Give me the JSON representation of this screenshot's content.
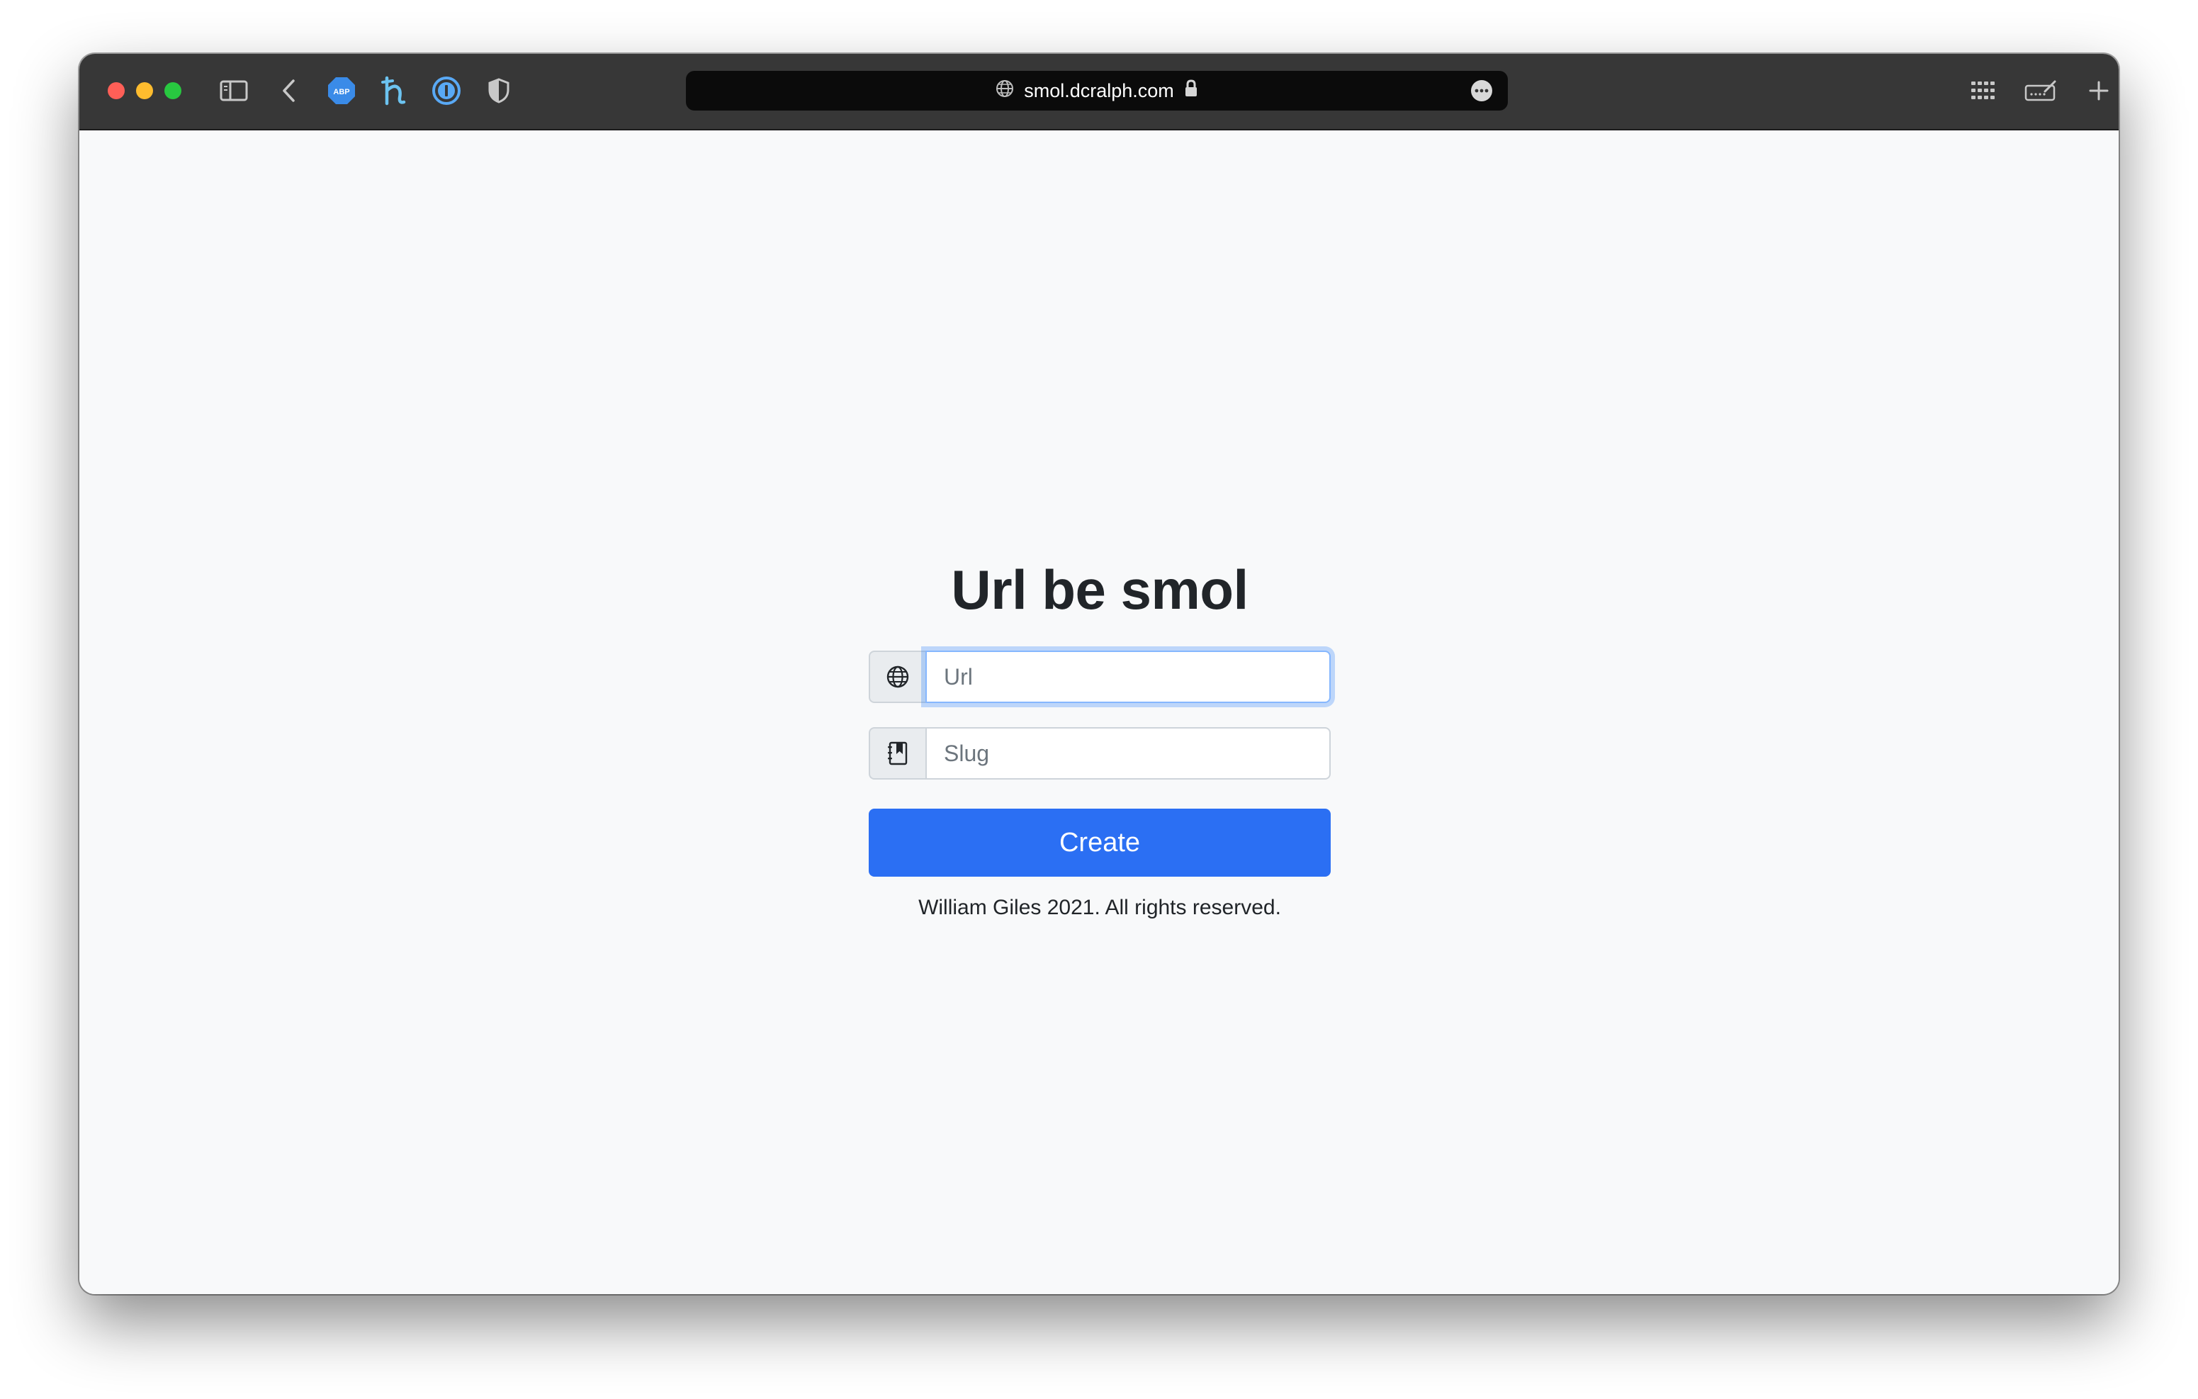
{
  "browser": {
    "url": "smol.dcralph.com",
    "extensions": [
      "abp-icon",
      "honey-icon",
      "onepassword-icon",
      "privacy-shield-icon"
    ]
  },
  "page": {
    "title": "Url be smol",
    "url_field": {
      "value": "",
      "placeholder": "Url",
      "icon": "globe-icon"
    },
    "slug_field": {
      "value": "",
      "placeholder": "Slug",
      "icon": "bookmark-book-icon"
    },
    "create_label": "Create",
    "footer": "William Giles 2021. All rights reserved."
  },
  "colors": {
    "accent": "#2b6ff3",
    "toolbar": "#373737",
    "page_bg": "#f8f9fa"
  }
}
